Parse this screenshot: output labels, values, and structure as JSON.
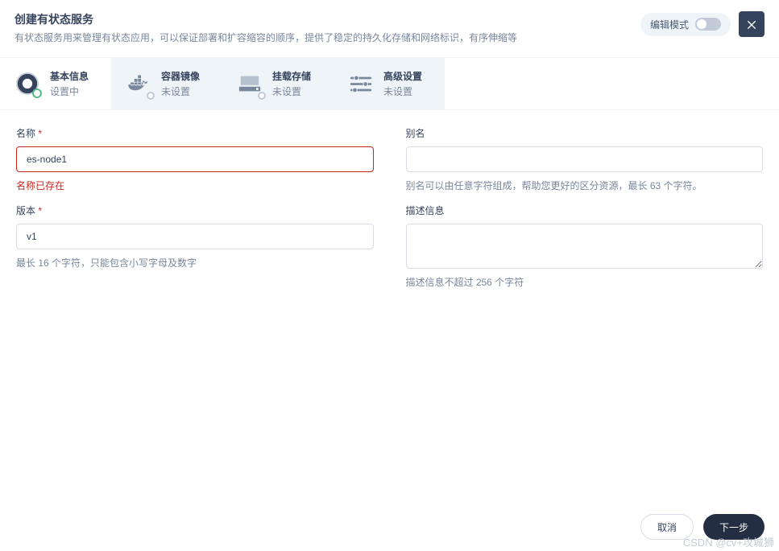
{
  "header": {
    "title": "创建有状态服务",
    "description": "有状态服务用来管理有状态应用，可以保证部署和扩容缩容的顺序，提供了稳定的持久化存储和网络标识，有序伸缩等",
    "toggle_label": "编辑模式"
  },
  "tabs": [
    {
      "title": "基本信息",
      "sub": "设置中",
      "active": true
    },
    {
      "title": "容器镜像",
      "sub": "未设置",
      "active": false
    },
    {
      "title": "挂载存储",
      "sub": "未设置",
      "active": false
    },
    {
      "title": "高级设置",
      "sub": "未设置",
      "active": false
    }
  ],
  "form": {
    "name": {
      "label": "名称",
      "value": "es-node1",
      "error": "名称已存在"
    },
    "alias": {
      "label": "别名",
      "value": "",
      "hint": "别名可以由任意字符组成，帮助您更好的区分资源，最长 63 个字符。"
    },
    "version": {
      "label": "版本",
      "value": "v1",
      "hint": "最长 16 个字符，只能包含小写字母及数字"
    },
    "description": {
      "label": "描述信息",
      "value": "",
      "hint": "描述信息不超过 256 个字符"
    }
  },
  "footer": {
    "cancel": "取消",
    "next": "下一步"
  },
  "watermark": "CSDN @cv+攻城狮"
}
